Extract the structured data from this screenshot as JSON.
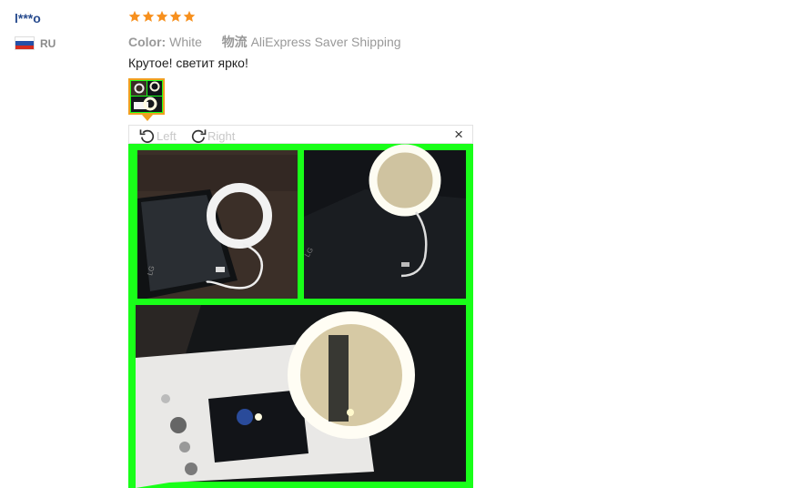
{
  "review": {
    "user": "l***o",
    "country": "RU",
    "rating": 5,
    "color_label": "Color:",
    "color_value": "White",
    "shipping_label": "物流",
    "shipping_value": "AliExpress Saver Shipping",
    "feedback": "Крутое! светит ярко!"
  },
  "viewer": {
    "rotate_left": "Left",
    "rotate_right": "Right",
    "close": "×"
  },
  "colors": {
    "user_link": "#2a4d8f",
    "star": "#f7901e",
    "thumb_border": "#f0a020",
    "photo_background": "#19ff19"
  },
  "icons": [
    "russia-flag-icon",
    "star-icon",
    "rotate-left-icon",
    "rotate-right-icon",
    "close-icon"
  ]
}
